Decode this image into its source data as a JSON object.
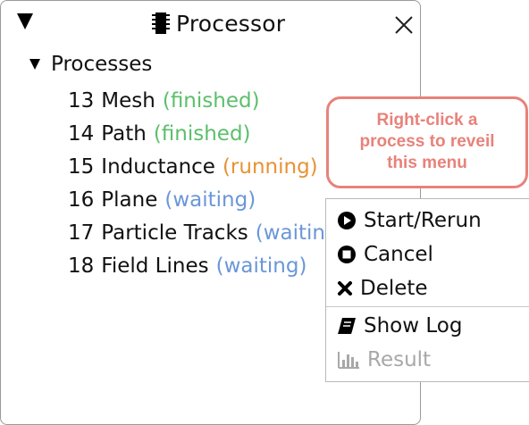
{
  "panel": {
    "title": "Processor",
    "title_icon": "chip-icon",
    "close_icon": "close-icon"
  },
  "tree": {
    "root_label": "Processes",
    "processes": [
      {
        "id": "13",
        "name": "Mesh",
        "status": "(finished)",
        "status_kind": "finished"
      },
      {
        "id": "14",
        "name": "Path",
        "status": "(finished)",
        "status_kind": "finished"
      },
      {
        "id": "15",
        "name": "Inductance",
        "status": "(running)",
        "status_kind": "running"
      },
      {
        "id": "16",
        "name": "Plane",
        "status": "(waiting)",
        "status_kind": "waiting"
      },
      {
        "id": "17",
        "name": "Particle Tracks",
        "status": "(waiting)",
        "status_kind": "waiting"
      },
      {
        "id": "18",
        "name": "Field Lines",
        "status": "(waiting)",
        "status_kind": "waiting"
      }
    ]
  },
  "callout": {
    "lines": [
      "Right-click a",
      "process to reveil",
      "this menu"
    ]
  },
  "context_menu": {
    "items": [
      {
        "label": "Start/Rerun",
        "icon": "play-icon",
        "enabled": true
      },
      {
        "label": "Cancel",
        "icon": "stop-icon",
        "enabled": true
      },
      {
        "label": "Delete",
        "icon": "x-icon",
        "enabled": true
      },
      {
        "label": "Show Log",
        "icon": "book-icon",
        "enabled": true
      },
      {
        "label": "Result",
        "icon": "bar-chart-icon",
        "enabled": false
      }
    ]
  },
  "colors": {
    "finished": "#5bbf6b",
    "running": "#e89234",
    "waiting": "#6a97d8",
    "callout": "#e8827a"
  }
}
